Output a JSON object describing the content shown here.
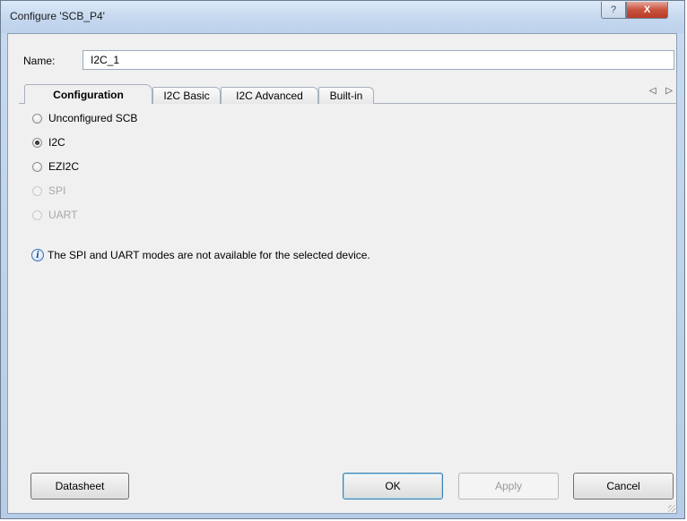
{
  "window": {
    "title": "Configure 'SCB_P4'",
    "help_glyph": "?",
    "close_glyph": "X"
  },
  "name_field": {
    "label": "Name:",
    "value": "I2C_1"
  },
  "tabs": [
    {
      "label": "Configuration",
      "active": true
    },
    {
      "label": "I2C Basic",
      "active": false
    },
    {
      "label": "I2C Advanced",
      "active": false
    },
    {
      "label": "Built-in",
      "active": false
    }
  ],
  "tab_scroll_glyphs": "◁ ▷",
  "modes": [
    {
      "label": "Unconfigured SCB",
      "checked": false,
      "disabled": false
    },
    {
      "label": "I2C",
      "checked": true,
      "disabled": false
    },
    {
      "label": "EZI2C",
      "checked": false,
      "disabled": false
    },
    {
      "label": "SPI",
      "checked": false,
      "disabled": true
    },
    {
      "label": "UART",
      "checked": false,
      "disabled": true
    }
  ],
  "info": {
    "icon": "info-icon",
    "text": "The SPI and UART modes are not available for the selected device."
  },
  "buttons": {
    "datasheet": "Datasheet",
    "ok": "OK",
    "apply": "Apply",
    "cancel": "Cancel"
  }
}
